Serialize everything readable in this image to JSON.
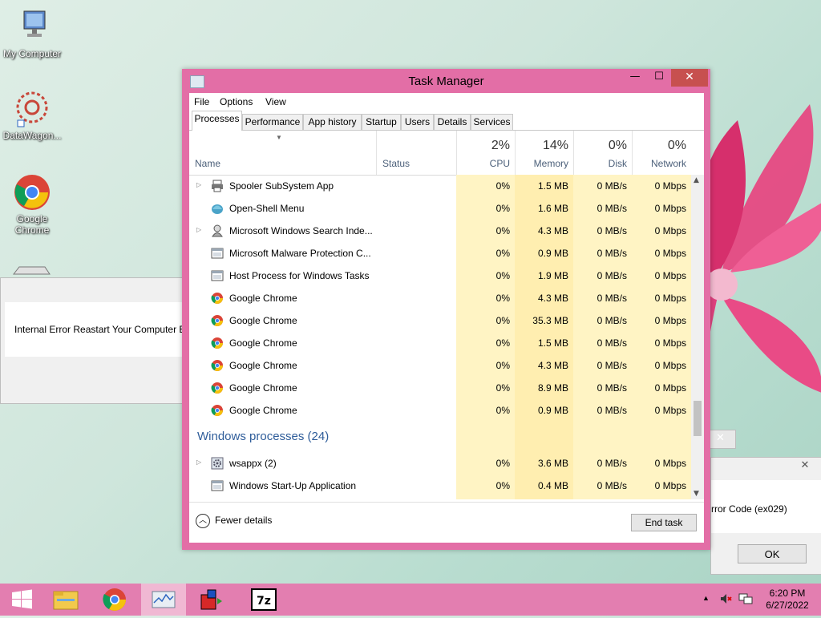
{
  "desktop": {
    "icons": [
      {
        "label": "My Computer",
        "icon": "computer-icon"
      },
      {
        "label": "DataWagon...",
        "icon": "datawagon-icon"
      },
      {
        "label": "Google Chrome",
        "icon": "chrome-icon"
      }
    ],
    "error_dialog": {
      "message": "Internal Error Reastart Your Computer Er"
    },
    "error_dialog_2": {
      "message": "rror Code (ex029)",
      "ok_label": "OK"
    }
  },
  "task_manager": {
    "title": "Task Manager",
    "menu": [
      "File",
      "Options",
      "View"
    ],
    "tabs": [
      "Processes",
      "Performance",
      "App history",
      "Startup",
      "Users",
      "Details",
      "Services"
    ],
    "active_tab": "Processes",
    "header": {
      "name": "Name",
      "status": "Status",
      "cpu_pct": "2%",
      "cpu": "CPU",
      "mem_pct": "14%",
      "mem": "Memory",
      "disk_pct": "0%",
      "disk": "Disk",
      "net_pct": "0%",
      "net": "Network"
    },
    "rows": [
      {
        "name": "Spooler SubSystem App",
        "icon": "printer-icon",
        "expand": true,
        "cpu": "0%",
        "mem": "1.5 MB",
        "disk": "0 MB/s",
        "net": "0 Mbps"
      },
      {
        "name": "Open-Shell Menu",
        "icon": "shell-icon",
        "expand": false,
        "cpu": "0%",
        "mem": "1.6 MB",
        "disk": "0 MB/s",
        "net": "0 Mbps"
      },
      {
        "name": "Microsoft Windows Search Inde...",
        "icon": "search-indexer-icon",
        "expand": true,
        "cpu": "0%",
        "mem": "4.3 MB",
        "disk": "0 MB/s",
        "net": "0 Mbps"
      },
      {
        "name": "Microsoft Malware Protection C...",
        "icon": "window-icon",
        "expand": false,
        "cpu": "0%",
        "mem": "0.9 MB",
        "disk": "0 MB/s",
        "net": "0 Mbps"
      },
      {
        "name": "Host Process for Windows Tasks",
        "icon": "window-icon",
        "expand": false,
        "cpu": "0%",
        "mem": "1.9 MB",
        "disk": "0 MB/s",
        "net": "0 Mbps"
      },
      {
        "name": "Google Chrome",
        "icon": "chrome-icon",
        "expand": false,
        "cpu": "0%",
        "mem": "4.3 MB",
        "disk": "0 MB/s",
        "net": "0 Mbps"
      },
      {
        "name": "Google Chrome",
        "icon": "chrome-icon",
        "expand": false,
        "cpu": "0%",
        "mem": "35.3 MB",
        "disk": "0 MB/s",
        "net": "0 Mbps"
      },
      {
        "name": "Google Chrome",
        "icon": "chrome-icon",
        "expand": false,
        "cpu": "0%",
        "mem": "1.5 MB",
        "disk": "0 MB/s",
        "net": "0 Mbps"
      },
      {
        "name": "Google Chrome",
        "icon": "chrome-icon",
        "expand": false,
        "cpu": "0%",
        "mem": "4.3 MB",
        "disk": "0 MB/s",
        "net": "0 Mbps"
      },
      {
        "name": "Google Chrome",
        "icon": "chrome-icon",
        "expand": false,
        "cpu": "0%",
        "mem": "8.9 MB",
        "disk": "0 MB/s",
        "net": "0 Mbps"
      },
      {
        "name": "Google Chrome",
        "icon": "chrome-icon",
        "expand": false,
        "cpu": "0%",
        "mem": "0.9 MB",
        "disk": "0 MB/s",
        "net": "0 Mbps"
      }
    ],
    "group_title": "Windows processes (24)",
    "rows2": [
      {
        "name": "wsappx (2)",
        "icon": "gear-icon",
        "expand": true,
        "cpu": "0%",
        "mem": "3.6 MB",
        "disk": "0 MB/s",
        "net": "0 Mbps"
      },
      {
        "name": "Windows Start-Up Application",
        "icon": "window-icon",
        "expand": false,
        "cpu": "0%",
        "mem": "0.4 MB",
        "disk": "0 MB/s",
        "net": "0 Mbps"
      }
    ],
    "fewer_details": "Fewer details",
    "end_task": "End task"
  },
  "taskbar": {
    "apps": [
      "start-icon",
      "file-explorer-icon",
      "chrome-icon",
      "task-manager-icon",
      "setup-icon",
      "7zip-icon"
    ],
    "time": "6:20 PM",
    "date": "6/27/2022"
  }
}
